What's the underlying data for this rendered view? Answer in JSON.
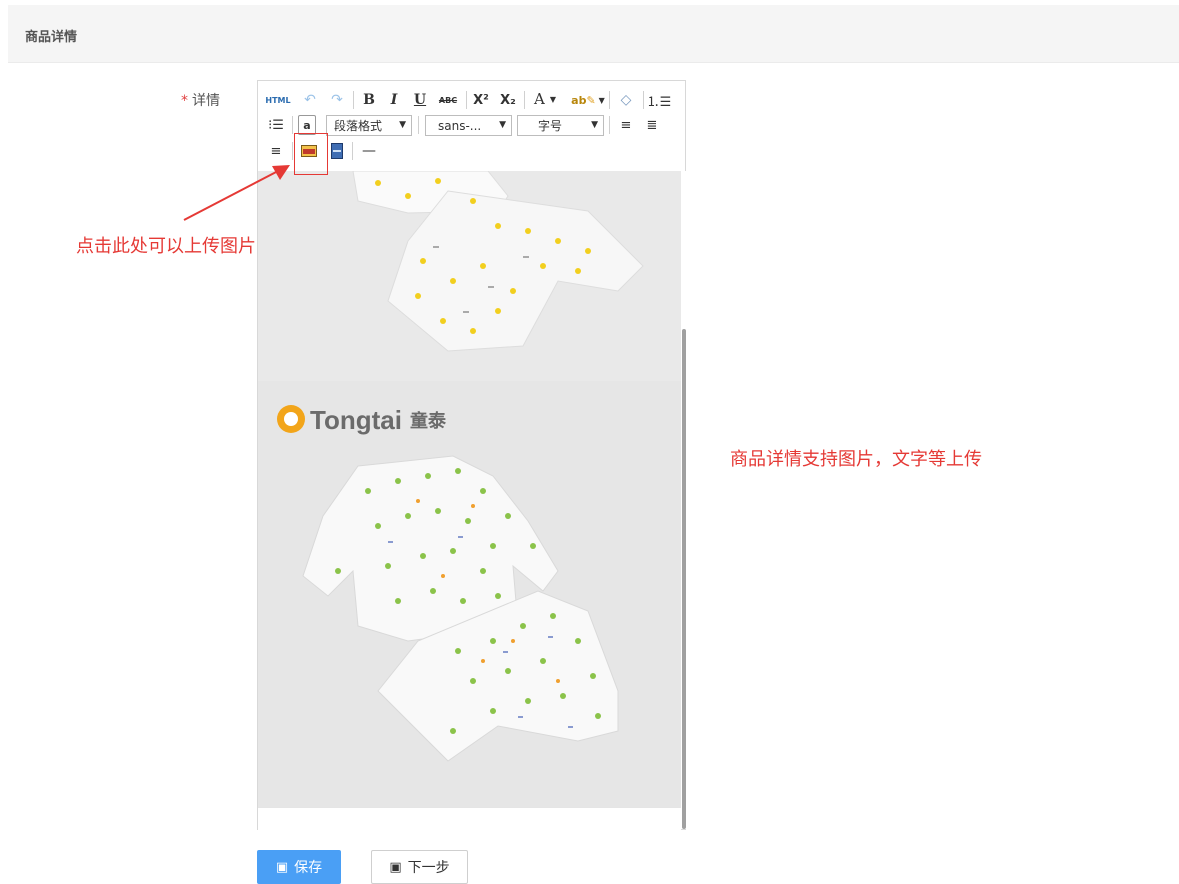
{
  "section": {
    "title": "商品详情"
  },
  "form": {
    "required_mark": "*",
    "label": "详情"
  },
  "toolbar": {
    "html": "HTML",
    "bold": "B",
    "italic": "I",
    "underline": "U",
    "strike": "ABC",
    "superscript": "X²",
    "subscript": "X₂",
    "font_color": "A",
    "highlight": "ab",
    "paragraph_format": "段落格式",
    "font_family": "sans-...",
    "font_size": "字号",
    "rule": "—"
  },
  "brand": {
    "name": "Tongtai",
    "chinese": "童泰"
  },
  "annotations": {
    "upload_hint": "点击此处可以上传图片",
    "support_hint": "商品详情支持图片，文字等上传"
  },
  "buttons": {
    "save": "保存",
    "next": "下一步"
  },
  "colors": {
    "accent": "#4a9ff5",
    "annotation": "#e53935",
    "required": "#e04040"
  }
}
